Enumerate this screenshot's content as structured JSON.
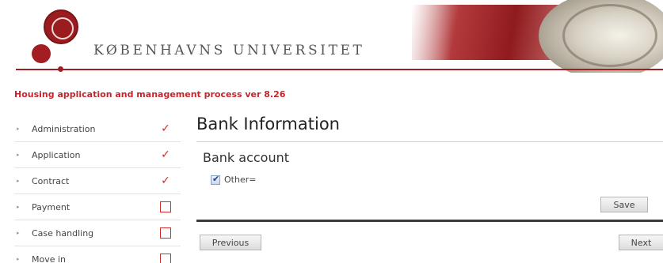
{
  "header": {
    "university_name": "KØBENHAVNS UNIVERSITET"
  },
  "process": {
    "title": "Housing application and management process ver 8.26"
  },
  "sidebar": {
    "items": [
      {
        "label": "Administration",
        "status": "done"
      },
      {
        "label": "Application",
        "status": "done"
      },
      {
        "label": "Contract",
        "status": "done"
      },
      {
        "label": "Payment",
        "status": "pending"
      },
      {
        "label": "Case handling",
        "status": "pending"
      },
      {
        "label": "Move in",
        "status": "pending"
      }
    ],
    "check_symbol": "✓",
    "bullet_symbol": "▸"
  },
  "main": {
    "page_title": "Bank Information",
    "section_title": "Bank account",
    "checkbox_label": "Other=",
    "checkbox_checked": true,
    "save_label": "Save",
    "previous_label": "Previous",
    "next_label": "Next"
  },
  "colors": {
    "brand_red": "#a31e22",
    "status_red": "#d12b2b",
    "title_red": "#c1272d"
  }
}
